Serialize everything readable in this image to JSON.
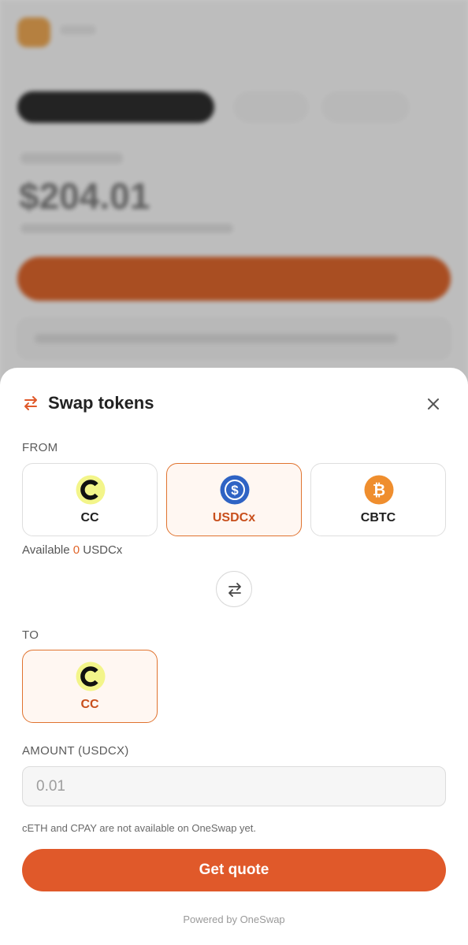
{
  "background": {
    "balance": "$204.01"
  },
  "sheet": {
    "title": "Swap tokens",
    "from_label": "FROM",
    "to_label": "TO",
    "from_tokens": [
      {
        "name": "CC",
        "icon": "cc-token-icon",
        "selected": false
      },
      {
        "name": "USDCx",
        "icon": "usdc-token-icon",
        "selected": true
      },
      {
        "name": "CBTC",
        "icon": "bitcoin-token-icon",
        "selected": false
      }
    ],
    "available": {
      "prefix": "Available",
      "amount": "0",
      "unit": "USDCx"
    },
    "to_tokens": [
      {
        "name": "CC",
        "icon": "cc-token-icon",
        "selected": true
      }
    ],
    "amount_label": "AMOUNT (USDCX)",
    "amount_placeholder": "0.01",
    "note": "cETH and CPAY are not available on OneSwap yet.",
    "get_quote_label": "Get quote",
    "powered_by": "Powered by OneSwap"
  },
  "colors": {
    "accent": "#e0592a",
    "selected_border": "#e0732f",
    "selected_bg": "#fff7f2",
    "usdc_blue": "#2f63c4",
    "btc_orange": "#ef8e2e",
    "cc_yellow": "#f3f58a"
  }
}
